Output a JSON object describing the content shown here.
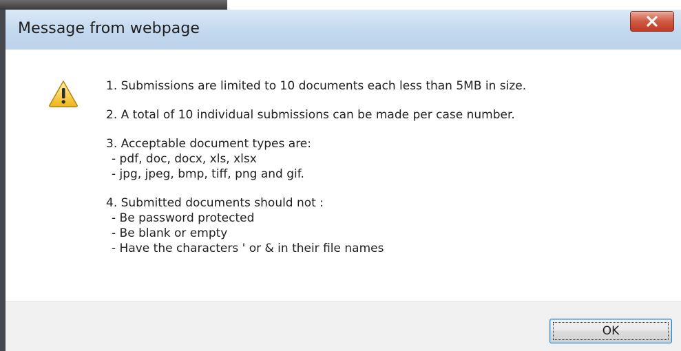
{
  "dialog": {
    "title": "Message from webpage",
    "icon": "warning-icon",
    "items": [
      {
        "lines": [
          "1. Submissions are limited to 10 documents each less than 5MB in size."
        ]
      },
      {
        "lines": [
          "2. A total of 10 individual submissions can be made per case number."
        ]
      },
      {
        "lines": [
          "3. Acceptable document types are:",
          "- pdf, doc, docx, xls, xlsx",
          "- jpg, jpeg, bmp, tiff, png and gif."
        ]
      },
      {
        "lines": [
          "4. Submitted documents should not :",
          "- Be password protected",
          "- Be blank or empty",
          "- Have the characters ' or & in their file names"
        ]
      }
    ],
    "ok_label": "OK"
  },
  "colors": {
    "close_button": "#c9452f",
    "titlebar": "#c3d8ee",
    "focus_border": "#3c7fb1"
  }
}
